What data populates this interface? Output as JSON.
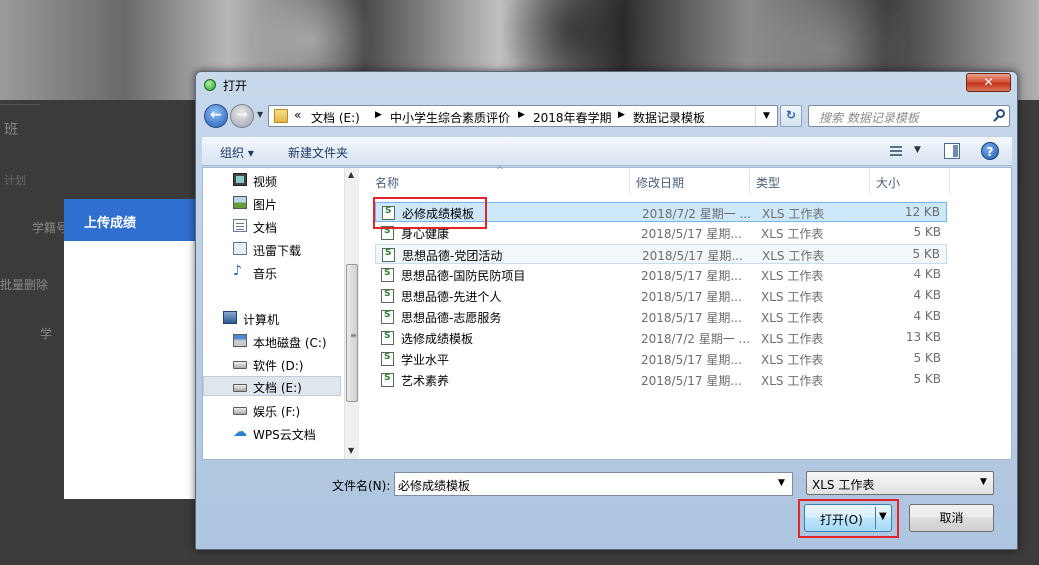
{
  "background": {
    "class_label": "班",
    "faded_text": "计划",
    "xueji_label": "学籍号",
    "batch_delete": "批量删除",
    "xue_label": "学",
    "upload_panel_title": "上传成绩"
  },
  "dialog": {
    "title": "打开",
    "close_glyph": "✕",
    "address": {
      "prefix": "«",
      "crumbs": [
        "文档 (E:)",
        "中小学生综合素质评价",
        "2018年春学期",
        "数据记录模板"
      ]
    },
    "search_placeholder": "搜索 数据记录模板",
    "toolbar": {
      "organize": "组织 ▾",
      "new_folder": "新建文件夹",
      "help": "?"
    },
    "nav_pane": {
      "items": [
        {
          "label": "视频",
          "icon": "video-icon"
        },
        {
          "label": "图片",
          "icon": "pictures-icon"
        },
        {
          "label": "文档",
          "icon": "documents-icon"
        },
        {
          "label": "迅雷下载",
          "icon": "download-icon"
        },
        {
          "label": "音乐",
          "icon": "music-icon"
        },
        {
          "label": "计算机",
          "icon": "computer-icon"
        },
        {
          "label": "本地磁盘 (C:)",
          "icon": "system-drive-icon"
        },
        {
          "label": "软件 (D:)",
          "icon": "drive-icon"
        },
        {
          "label": "文档 (E:)",
          "icon": "drive-icon",
          "selected": true
        },
        {
          "label": "娱乐 (F:)",
          "icon": "drive-icon"
        },
        {
          "label": "WPS云文档",
          "icon": "cloud-icon"
        }
      ]
    },
    "columns": [
      "名称",
      "修改日期",
      "类型",
      "大小"
    ],
    "files": [
      {
        "name": "必修成绩模板",
        "date": "2018/7/2 星期一 ...",
        "type": "XLS 工作表",
        "size": "12 KB",
        "selected": true
      },
      {
        "name": "身心健康",
        "date": "2018/5/17 星期...",
        "type": "XLS 工作表",
        "size": "5 KB"
      },
      {
        "name": "思想品德-党团活动",
        "date": "2018/5/17 星期...",
        "type": "XLS 工作表",
        "size": "5 KB",
        "hover": true
      },
      {
        "name": "思想品德-国防民防项目",
        "date": "2018/5/17 星期...",
        "type": "XLS 工作表",
        "size": "4 KB"
      },
      {
        "name": "思想品德-先进个人",
        "date": "2018/5/17 星期...",
        "type": "XLS 工作表",
        "size": "4 KB"
      },
      {
        "name": "思想品德-志愿服务",
        "date": "2018/5/17 星期...",
        "type": "XLS 工作表",
        "size": "4 KB"
      },
      {
        "name": "选修成绩模板",
        "date": "2018/7/2 星期一 ...",
        "type": "XLS 工作表",
        "size": "13 KB"
      },
      {
        "name": "学业水平",
        "date": "2018/5/17 星期...",
        "type": "XLS 工作表",
        "size": "5 KB"
      },
      {
        "name": "艺术素养",
        "date": "2018/5/17 星期...",
        "type": "XLS 工作表",
        "size": "5 KB"
      }
    ],
    "filename_label": "文件名(N):",
    "filename_value": "必修成绩模板",
    "filetype_value": "XLS 工作表",
    "open_button": "打开(O)",
    "cancel_button": "取消",
    "highlight_color": "#e0262c",
    "accent_color": "#2f6fd0"
  }
}
